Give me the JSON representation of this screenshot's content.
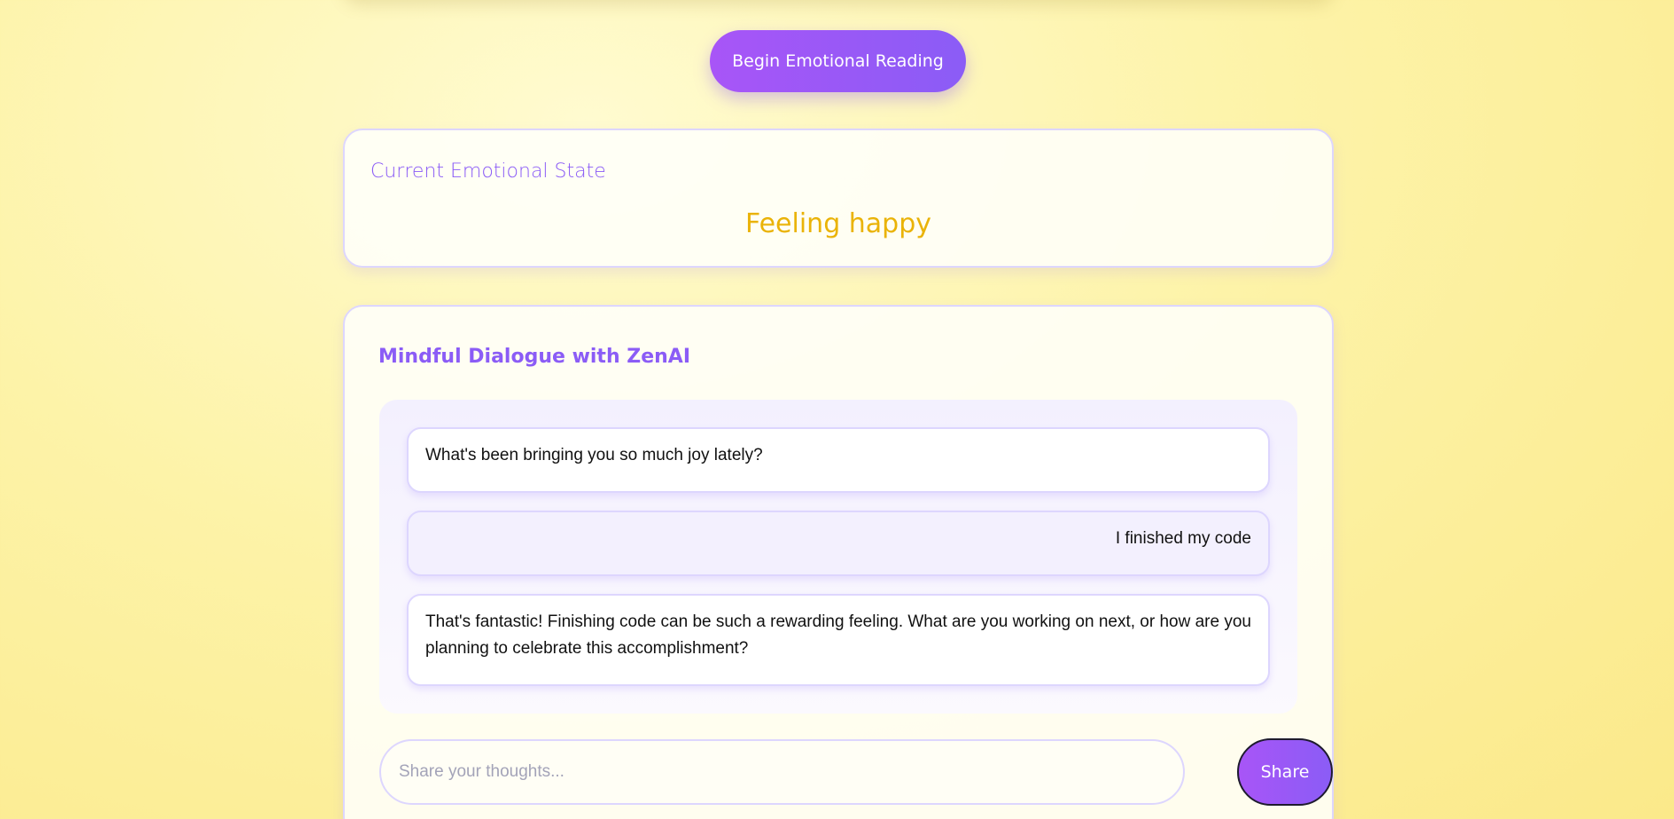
{
  "theme": {
    "accent": "#8b5cf6",
    "accent_light": "#a855f7",
    "mood_color": "#eab308",
    "border": "#ddd6fe"
  },
  "header": {
    "begin_button_label": "Begin Emotional Reading"
  },
  "emotional_state": {
    "title": "Current Emotional State",
    "value": "Feeling happy"
  },
  "dialogue": {
    "title": "Mindful Dialogue with ZenAI",
    "messages": [
      {
        "sender": "ai",
        "text": "What's been bringing you so much joy lately?"
      },
      {
        "sender": "user",
        "text": "I finished my code"
      },
      {
        "sender": "ai",
        "text": "That's fantastic! Finishing code can be such a rewarding feeling. What are you working on next, or how are you planning to celebrate this accomplishment?"
      }
    ],
    "input": {
      "value": "",
      "placeholder": "Share your thoughts..."
    },
    "share_button_label": "Share"
  }
}
